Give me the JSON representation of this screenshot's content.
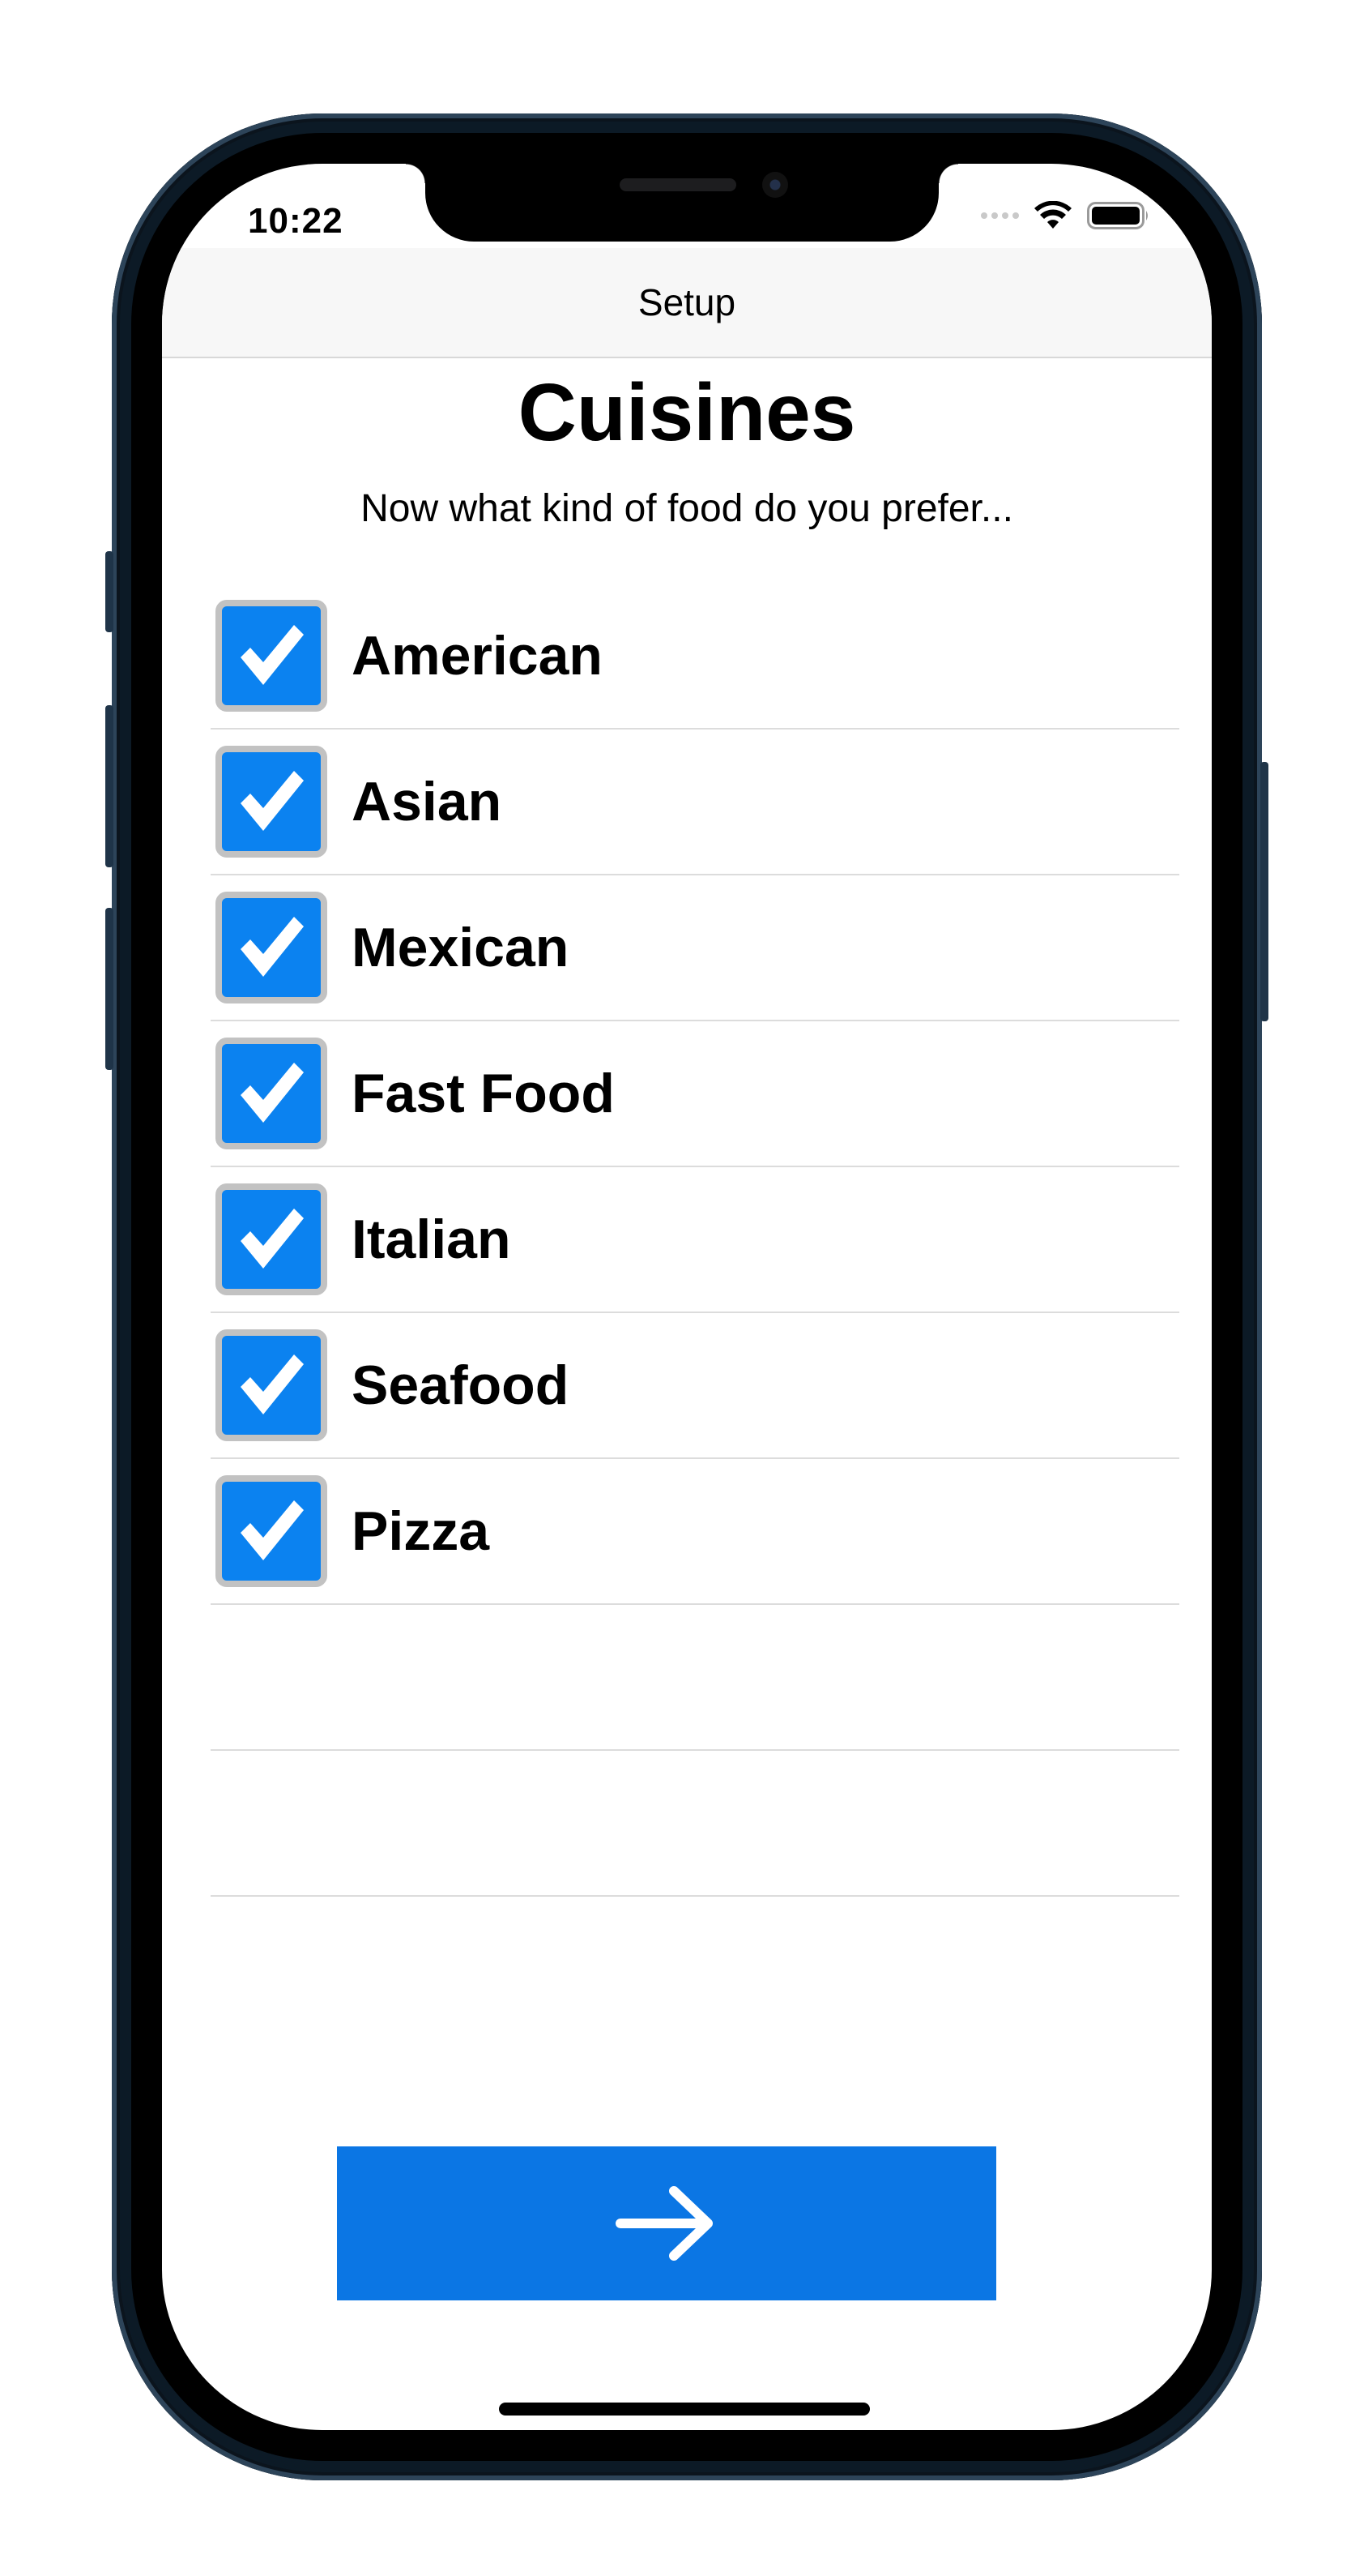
{
  "status_bar": {
    "time": "10:22",
    "icons": [
      "cellular-signal-icon",
      "wifi-icon",
      "battery-icon"
    ]
  },
  "navbar": {
    "title": "Setup"
  },
  "page": {
    "title": "Cuisines",
    "subtitle": "Now what kind of food do you prefer..."
  },
  "cuisines": [
    {
      "label": "American",
      "checked": true
    },
    {
      "label": "Asian",
      "checked": true
    },
    {
      "label": "Mexican",
      "checked": true
    },
    {
      "label": "Fast Food",
      "checked": true
    },
    {
      "label": "Italian",
      "checked": true
    },
    {
      "label": "Seafood",
      "checked": true
    },
    {
      "label": "Pizza",
      "checked": true
    }
  ],
  "next_button": {
    "icon": "arrow-right-icon"
  },
  "colors": {
    "accent": "#0b76e4",
    "checkbox_fill": "#0b82f0",
    "checkbox_border": "#c2c2c2",
    "navbar_bg": "#f7f7f7"
  }
}
